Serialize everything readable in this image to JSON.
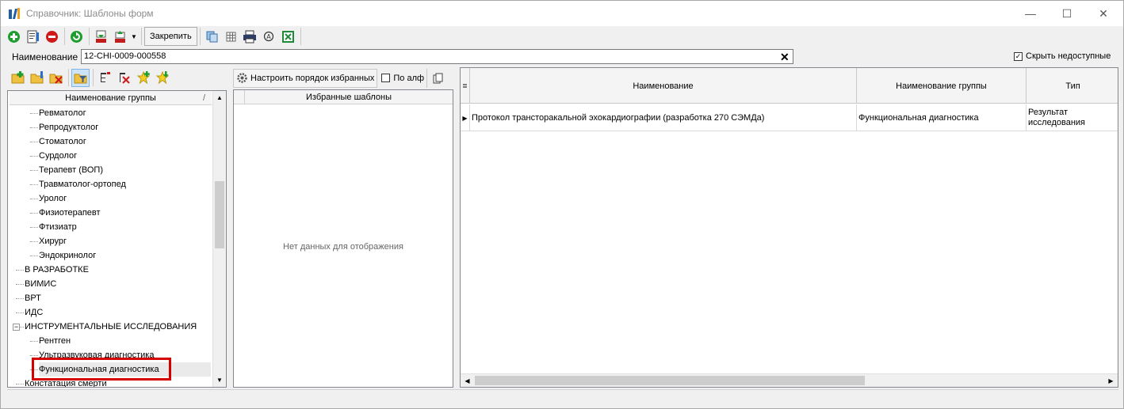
{
  "window": {
    "title": "Справочник: Шаблоны форм"
  },
  "toolbar": {
    "pin_label": "Закрепить"
  },
  "search": {
    "label": "Наименование",
    "value": "12-CHI-0009-000558",
    "hide_unavailable_label": "Скрыть недоступные",
    "hide_unavailable_checked": true
  },
  "tree": {
    "header": "Наименование группы",
    "sort_indicator": "/",
    "items": [
      {
        "label": "Ревматолог",
        "level": 2
      },
      {
        "label": "Репродуктолог",
        "level": 2
      },
      {
        "label": "Стоматолог",
        "level": 2
      },
      {
        "label": "Сурдолог",
        "level": 2
      },
      {
        "label": "Терапевт (ВОП)",
        "level": 2
      },
      {
        "label": "Травматолог-ортопед",
        "level": 2
      },
      {
        "label": "Уролог",
        "level": 2
      },
      {
        "label": "Физиотерапевт",
        "level": 2
      },
      {
        "label": "Фтизиатр",
        "level": 2
      },
      {
        "label": "Хирург",
        "level": 2
      },
      {
        "label": "Эндокринолог",
        "level": 2
      },
      {
        "label": "В РАЗРАБОТКЕ",
        "level": 1
      },
      {
        "label": "ВИМИС",
        "level": 1
      },
      {
        "label": "ВРТ",
        "level": 1
      },
      {
        "label": "ИДС",
        "level": 1
      },
      {
        "label": "ИНСТРУМЕНТАЛЬНЫЕ ИССЛЕДОВАНИЯ",
        "level": 1,
        "expanded": true
      },
      {
        "label": "Рентген",
        "level": 2
      },
      {
        "label": "Ультразвуковая диагностика",
        "level": 2
      },
      {
        "label": "Функциональная диагностика",
        "level": 2,
        "selected": true
      },
      {
        "label": "Констатация смерти",
        "level": 1
      }
    ]
  },
  "favorites": {
    "configure_label": "Настроить порядок избранных",
    "alpha_label": "По алф",
    "header": "Избранные шаблоны",
    "empty_text": "Нет данных для отображения"
  },
  "grid": {
    "columns": [
      "Наименование",
      "Наименование группы",
      "Тип"
    ],
    "rows": [
      [
        "Протокол трансторакальной эхокардиографии (разработка 270 СЭМДа)",
        "Функциональная диагностика",
        "Результат исследования"
      ]
    ]
  },
  "colors": {
    "highlight": "#d40000",
    "accent_green": "#1e9e2e",
    "accent_red": "#d01818"
  }
}
